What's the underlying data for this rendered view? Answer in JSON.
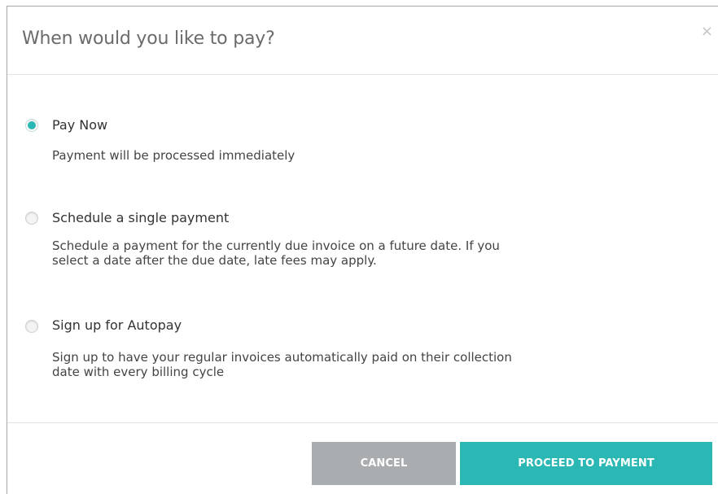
{
  "dialog": {
    "title": "When would you like to pay?",
    "close_glyph": "×"
  },
  "options": [
    {
      "label": "Pay Now",
      "description": "Payment will be processed immediately",
      "selected": true
    },
    {
      "label": "Schedule a single payment",
      "description_lines": [
        "Schedule a payment for the currently due invoice on a future date. If you",
        "select a date after the due date, late fees may apply."
      ],
      "selected": false
    },
    {
      "label": "Sign up for Autopay",
      "description_lines": [
        "Sign up to have your regular invoices automatically paid on their collection",
        "date with every billing cycle"
      ],
      "selected": false
    }
  ],
  "buttons": {
    "cancel_label": "CANCEL",
    "proceed_label": "PROCEED TO PAYMENT"
  },
  "colors": {
    "accent": "#2bb8b4",
    "cancel_bg": "#a9adb0"
  }
}
